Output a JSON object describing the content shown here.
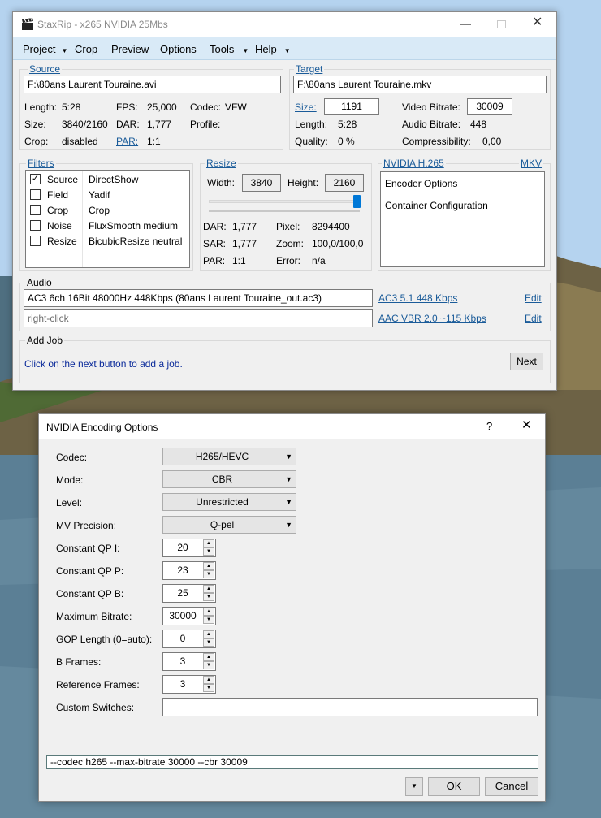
{
  "main_window": {
    "title": "StaxRip - x265 NVIDIA 25Mbs",
    "menu": [
      "Project",
      "Crop",
      "Preview",
      "Options",
      "Tools",
      "Help"
    ],
    "source": {
      "label": "Source",
      "path": "F:\\80ans Laurent Touraine.avi",
      "length_label": "Length:",
      "length": "5:28",
      "fps_label": "FPS:",
      "fps": "25,000",
      "codec_label": "Codec:",
      "codec": "VFW",
      "size_label": "Size:",
      "size": "3840/2160",
      "dar_label": "DAR:",
      "dar": "1,777",
      "profile_label": "Profile:",
      "crop_label": "Crop:",
      "crop": "disabled",
      "par_label": "PAR:",
      "par": "1:1"
    },
    "target": {
      "label": "Target",
      "path": "F:\\80ans Laurent Touraine.mkv",
      "size_label": "Size:",
      "size": "1191",
      "video_bitrate_label": "Video Bitrate:",
      "video_bitrate": "30009",
      "length_label": "Length:",
      "length": "5:28",
      "audio_bitrate_label": "Audio Bitrate:",
      "audio_bitrate": "448",
      "quality_label": "Quality:",
      "quality": "0 %",
      "compressibility_label": "Compressibility:",
      "compressibility": "0,00"
    },
    "filters": {
      "label": "Filters",
      "items": [
        {
          "checked": true,
          "name": "Source",
          "value": "DirectShow"
        },
        {
          "checked": false,
          "name": "Field",
          "value": "Yadif"
        },
        {
          "checked": false,
          "name": "Crop",
          "value": "Crop"
        },
        {
          "checked": false,
          "name": "Noise",
          "value": "FluxSmooth medium"
        },
        {
          "checked": false,
          "name": "Resize",
          "value": "BicubicResize neutral"
        }
      ]
    },
    "resize": {
      "label": "Resize",
      "width_label": "Width:",
      "width": "3840",
      "height_label": "Height:",
      "height": "2160",
      "slider_fraction": 1.0,
      "dar_label": "DAR:",
      "dar": "1,777",
      "pixel_label": "Pixel:",
      "pixel": "8294400",
      "sar_label": "SAR:",
      "sar": "1,777",
      "zoom_label": "Zoom:",
      "zoom": "100,0/100,0",
      "par_label": "PAR:",
      "par": "1:1",
      "error_label": "Error:",
      "error": "n/a"
    },
    "encoder": {
      "label": "NVIDIA H.265",
      "container": "MKV",
      "items": [
        "Encoder Options",
        "Container Configuration"
      ]
    },
    "audio": {
      "label": "Audio",
      "track1": "AC3 6ch 16Bit 48000Hz 448Kbps (80ans Laurent Touraine_out.ac3)",
      "track1_profile": "AC3 5.1 448 Kbps",
      "track2": "right-click",
      "track2_profile": "AAC VBR 2.0 ~115 Kbps",
      "edit": "Edit"
    },
    "add_job": {
      "label": "Add Job",
      "hint": "Click on the next button to add a job.",
      "next": "Next"
    }
  },
  "dialog": {
    "title": "NVIDIA Encoding Options",
    "help": "?",
    "close": "✕",
    "combos": [
      {
        "label": "Codec:",
        "value": "H265/HEVC"
      },
      {
        "label": "Mode:",
        "value": "CBR"
      },
      {
        "label": "Level:",
        "value": "Unrestricted"
      },
      {
        "label": "MV Precision:",
        "value": "Q-pel"
      }
    ],
    "spins": [
      {
        "label": "Constant QP I:",
        "value": "20"
      },
      {
        "label": "Constant QP P:",
        "value": "23"
      },
      {
        "label": "Constant QP B:",
        "value": "25"
      },
      {
        "label": "Maximum Bitrate:",
        "value": "30000"
      },
      {
        "label": "GOP Length (0=auto):",
        "value": "0"
      },
      {
        "label": "B Frames:",
        "value": "3"
      },
      {
        "label": "Reference Frames:",
        "value": "3"
      }
    ],
    "custom_switches_label": "Custom Switches:",
    "custom_switches": "",
    "command_line": "--codec h265 --max-bitrate 30000 --cbr 30009",
    "ok": "OK",
    "cancel": "Cancel"
  },
  "colors": {
    "menubar": "#d9eaf7",
    "link": "#1a5b99",
    "hint": "#0a2a9a"
  }
}
